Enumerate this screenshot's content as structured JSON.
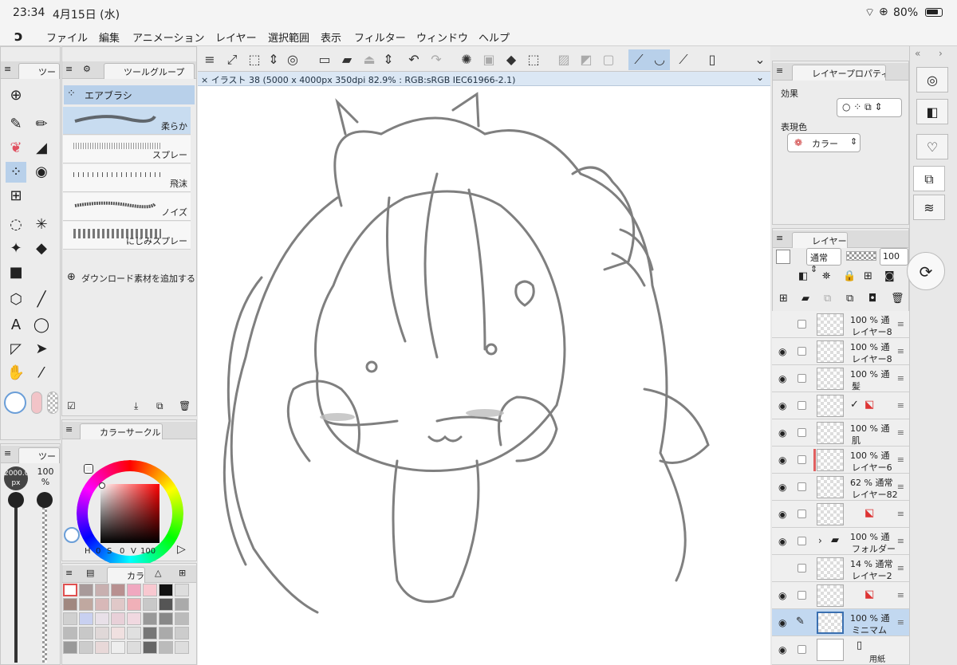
{
  "status": {
    "time": "23:34",
    "date": "4月15日 (水)",
    "battery": "80%"
  },
  "menu": [
    "ファイル",
    "編集",
    "アニメーション",
    "レイヤー",
    "選択範囲",
    "表示",
    "フィルター",
    "ウィンドウ",
    "ヘルプ"
  ],
  "canvas": {
    "title": "× イラスト 38 (5000 x 4000px 350dpi 82.9% : RGB:sRGB IEC61966-2.1)"
  },
  "tool_panel": {
    "tab": "ツー"
  },
  "tool_group": {
    "tab": "ツールグループ",
    "selected": "エアブラシ",
    "brushes": [
      "柔らか",
      "スプレー",
      "飛沫",
      "ノイズ",
      "にじみスプレー"
    ],
    "add_material": "ダウンロード素材を追加する"
  },
  "size_panel": {
    "tab": "ツー",
    "size": "2000.0",
    "unit": "px",
    "opacity": "100",
    "opacity_unit": "%"
  },
  "color_circle": {
    "tab": "カラーサークル",
    "h": "0",
    "s": "0",
    "v": "100",
    "h_label": "H",
    "s_label": "S",
    "v_label": "V"
  },
  "color_set": {
    "tab": "カラ"
  },
  "layer_property": {
    "tab": "レイヤープロパティ",
    "effect": "効果",
    "expression": "表現色",
    "color_mode": "カラー"
  },
  "layer_panel": {
    "tab": "レイヤー",
    "blend": "通常",
    "opacity": "100",
    "layers": [
      {
        "pct": "100 %",
        "mode": "通",
        "name": "レイヤー8",
        "visible": false
      },
      {
        "pct": "100 %",
        "mode": "通",
        "name": "レイヤー8",
        "visible": true
      },
      {
        "pct": "100 %",
        "mode": "通",
        "name": "髪",
        "visible": true
      },
      {
        "pct": "",
        "mode": "",
        "name": "",
        "visible": true
      },
      {
        "pct": "100 %",
        "mode": "通",
        "name": "肌",
        "visible": true
      },
      {
        "pct": "100 %",
        "mode": "通",
        "name": "レイヤー6",
        "visible": true
      },
      {
        "pct": "62 %",
        "mode": "通常",
        "name": "レイヤー82",
        "visible": true
      },
      {
        "pct": "",
        "mode": "",
        "name": "",
        "visible": true
      },
      {
        "pct": "100 %",
        "mode": "通",
        "name": "フォルダー",
        "visible": true
      },
      {
        "pct": "14 %",
        "mode": "通常",
        "name": "レイヤー2",
        "visible": false
      },
      {
        "pct": "",
        "mode": "",
        "name": "",
        "visible": true
      },
      {
        "pct": "100 %",
        "mode": "通",
        "name": "ミニマム",
        "visible": true
      },
      {
        "pct": "",
        "mode": "",
        "name": "用紙",
        "visible": true
      }
    ]
  },
  "colors": {
    "accent": "#b8d0ea",
    "selected_layer": "#c2d8f0",
    "fg_color": "#f2c4c8"
  }
}
